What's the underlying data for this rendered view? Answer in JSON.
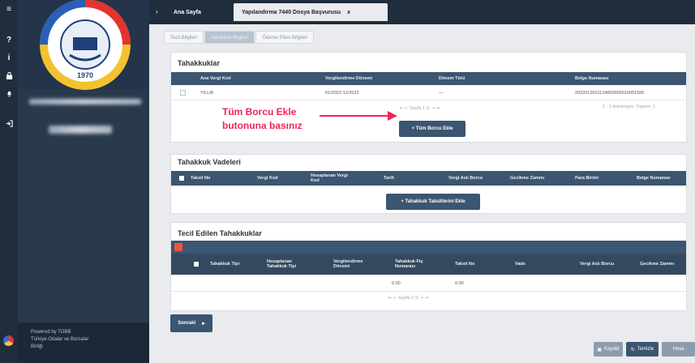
{
  "sidebar": {
    "powered_by": "Powered by TOBB",
    "org_line1": "Türkiye Odalar ve Borsalar",
    "org_line2": "Birliği"
  },
  "tabs": {
    "home": "Ana Sayfa",
    "active": "Yapılandırma 7440 Dosya Başvurusu",
    "close": "x"
  },
  "subtabs": [
    "Tecil Bilgileri",
    "Tahakkuk Bilgileri",
    "Ödeme Planı Bilgileri"
  ],
  "tahakkuklar": {
    "title": "Tahakkuklar",
    "headers": [
      "Ana Vergi Kod",
      "Vergilendirme Dönemi",
      "Dönem Türü",
      "Belge Numarası"
    ],
    "row": {
      "kod": "YILLIK",
      "donem": "01/2022-12/2022",
      "donem_turu": "—",
      "belge": "2022012601124600000010051505"
    },
    "pager": "⇤ ⇠ Sayfa 1 /1 ⇢ ⇥",
    "summary": "1 - 1 listeleniyor, Toplam: 1",
    "button": "+ Tüm Borcu Ekle"
  },
  "annotation": {
    "line1": "Tüm Borcu Ekle",
    "line2": "butonuna basınız"
  },
  "vadeler": {
    "title": "Tahakkuk Vadeleri",
    "headers": [
      "Taksit No",
      "Vergi Kod",
      "Hesaplanan Vergi Kod",
      "Tarih",
      "Vergi Aslı Borcu",
      "Gecikme Zammı",
      "Para Birimi",
      "Belge Numarası"
    ],
    "button": "+ Tahakkuk Taksitlerini Ekle"
  },
  "tecil": {
    "title": "Tecil Edilen Tahakkuklar",
    "headers": [
      "Tahakkuk Tipi",
      "Hesaplanan Tahakkuk Tipi",
      "Vergilendirme Dönemi",
      "Tahakkuk Fiş Numarası",
      "Taksit No",
      "Vade",
      "Vergi Aslı Borcu",
      "Gecikme Zammı"
    ],
    "val1": "0.00",
    "val2": "0.00",
    "pager": "⇤ ⇠ Sayfa 1 /1 ⇢ ⇥"
  },
  "footer": {
    "next": "Sonraki",
    "save": "Kaydet",
    "clear": "Temizle",
    "third": "Hesa"
  },
  "colors": {
    "header": "#3c5570",
    "accent": "#f0265a"
  }
}
